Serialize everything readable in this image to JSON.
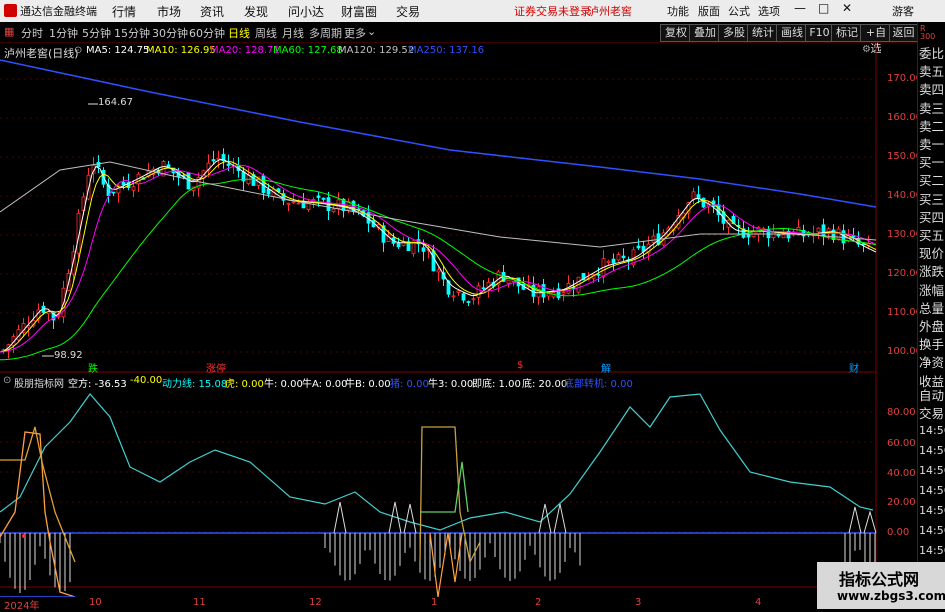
{
  "app_title": "通达信金融终端",
  "menu": [
    "行情",
    "市场",
    "资讯",
    "发现",
    "问小达",
    "财富圈",
    "交易"
  ],
  "login_status": "证券交易未登录",
  "current_stock_top": "泸州老窖",
  "menu_right": [
    "功能",
    "版面",
    "公式",
    "选项"
  ],
  "guest": "游客",
  "periods": [
    "分时",
    "1分钟",
    "5分钟",
    "15分钟",
    "30分钟",
    "60分钟",
    "日线",
    "周线",
    "月线",
    "多周期",
    "更多"
  ],
  "active_period": "日线",
  "right_buttons": [
    "复权",
    "叠加",
    "多股",
    "统计",
    "画线",
    "F10",
    "标记",
    "+自选",
    "返回"
  ],
  "stock_title": "泸州老窖(日线)",
  "ma": [
    {
      "label": "MA5: 124.75",
      "color": "#ffffff"
    },
    {
      "label": "MA10: 126.95",
      "color": "#ffff00"
    },
    {
      "label": "MA20: 128.71",
      "color": "#ff00ff"
    },
    {
      "label": "MA60: 127.68",
      "color": "#00ff00"
    },
    {
      "label": "MA120: 129.52",
      "color": "#c0c0c0"
    },
    {
      "label": "MA250: 137.16",
      "color": "#3050ff"
    }
  ],
  "price_axis": [
    "170.00",
    "160.00",
    "150.00",
    "140.00",
    "130.00",
    "120.00",
    "110.00",
    "100.00"
  ],
  "high_label": "164.67",
  "low_label": "98.92",
  "event_marks": [
    {
      "text": "跌",
      "color": "#00ff00"
    },
    {
      "text": "涨停",
      "color": "#ff3030"
    },
    {
      "text": "$",
      "color": "#ff3030"
    },
    {
      "text": "解",
      "color": "#00a0ff"
    },
    {
      "text": "财",
      "color": "#00a0ff"
    }
  ],
  "indicator": {
    "name": "股朋指标网",
    "fields": [
      {
        "label": "空方: -36.53",
        "color": "#ffffff"
      },
      {
        "label": "-40.00",
        "color": "#ffff00"
      },
      {
        "label": "动力线: 15.08",
        "color": "#00ffff"
      },
      {
        "label": "虎: 0.00",
        "color": "#ffff00"
      },
      {
        "label": "牛: 0.00",
        "color": "#ffffff"
      },
      {
        "label": "牛A: 0.00",
        "color": "#ffffff"
      },
      {
        "label": "牛B: 0.00",
        "color": "#ffffff"
      },
      {
        "label": "猪: 0.00",
        "color": "#3050ff"
      },
      {
        "label": "牛3: 0.00",
        "color": "#ffffff"
      },
      {
        "label": "即底: 1.00",
        "color": "#ffffff"
      },
      {
        "label": "底: 20.00",
        "color": "#ffffff"
      },
      {
        "label": "底部转机: 0.00",
        "color": "#3050ff"
      }
    ],
    "axis": [
      "80.00",
      "60.00",
      "40.00",
      "20.00",
      "0.00"
    ]
  },
  "date_axis": [
    "2024年",
    "10",
    "11",
    "12",
    "1",
    "2",
    "3",
    "4"
  ],
  "sidebar_items": [
    "委比",
    "卖五",
    "卖四",
    "卖三",
    "卖二",
    "卖一",
    "买一",
    "买二",
    "买三",
    "买四",
    "买五",
    "现价",
    "涨跌",
    "涨幅",
    "总量",
    "外盘",
    "换手",
    "净资",
    "收益"
  ],
  "sidebar_lower": [
    "自动",
    "交易",
    "14:56",
    "14:56",
    "14:56",
    "14:56",
    "14:56",
    "14:56",
    "14:56",
    "14:56"
  ],
  "watermark": "指标公式网",
  "watermark_url": "www.zbgs3.com",
  "colors": {
    "up": "#ff3030",
    "down": "#00ffff",
    "ma250": "#3050ff",
    "grid": "#600000"
  }
}
